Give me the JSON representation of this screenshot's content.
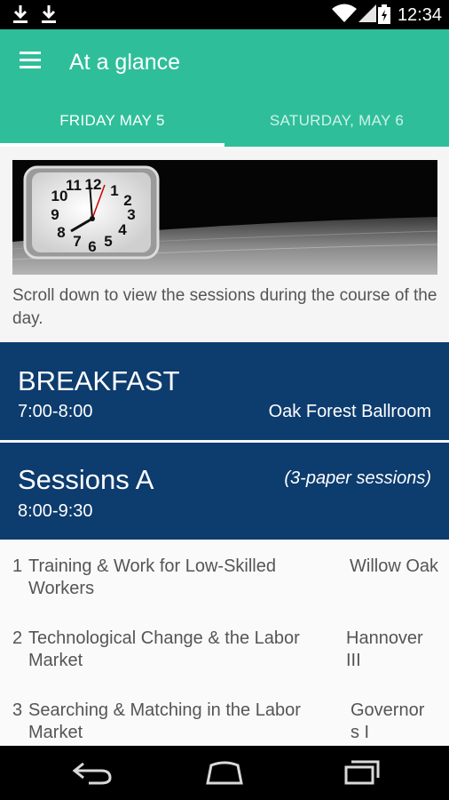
{
  "status_bar": {
    "time": "12:34"
  },
  "app_bar": {
    "title": "At a glance",
    "tabs": [
      {
        "label": "FRIDAY MAY 5",
        "selected": true
      },
      {
        "label": "SATURDAY, MAY 6",
        "selected": false
      }
    ]
  },
  "content": {
    "caption": "Scroll down to view the sessions during the course of the day."
  },
  "breakfast": {
    "name": "BREAKFAST",
    "time": "7:00-8:00",
    "location": "Oak Forest Ballroom"
  },
  "sessions_a": {
    "name": "Sessions A",
    "note": "(3-paper sessions)",
    "time": "8:00-9:30",
    "items": [
      {
        "number": "1",
        "title": "Training & Work for Low-Skilled Workers",
        "room": "Willow Oak"
      },
      {
        "number": "2",
        "title": "Technological Change & the Labor Market",
        "room": "Hannover III"
      },
      {
        "number": "3",
        "title": "Searching & Matching in the Labor Market",
        "room": "Governor s I"
      }
    ]
  },
  "colors": {
    "primary": "#2ebf9a",
    "block": "#0d3c6e"
  }
}
